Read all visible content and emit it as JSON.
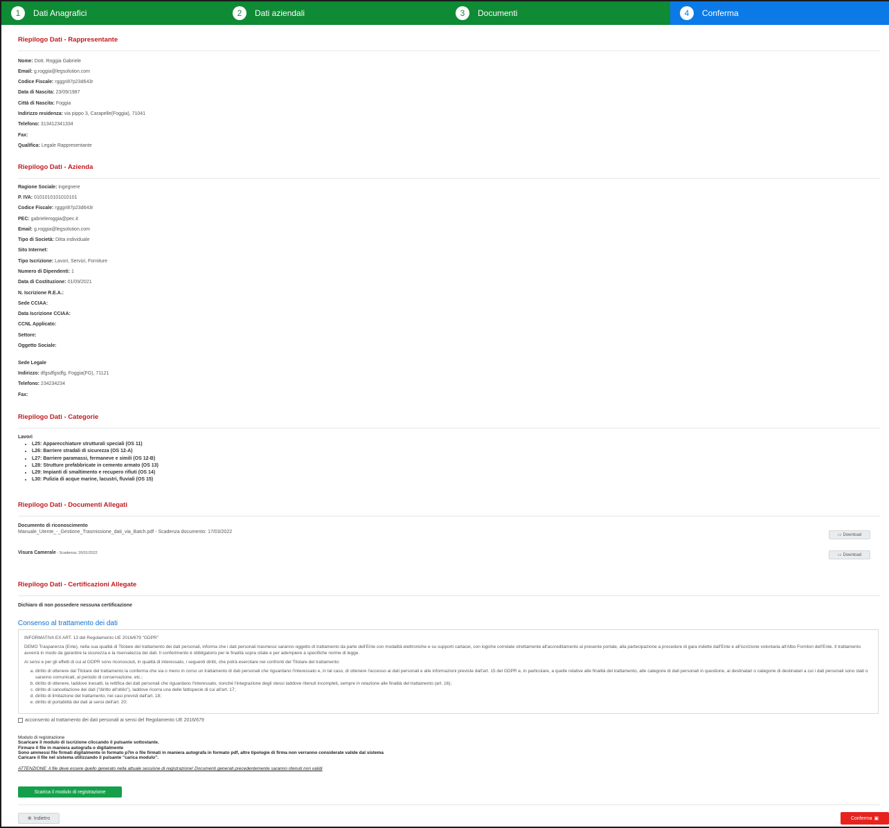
{
  "stepper": [
    {
      "num": "1",
      "label": "Dati Anagrafici"
    },
    {
      "num": "2",
      "label": "Dati aziendali"
    },
    {
      "num": "3",
      "label": "Documenti"
    },
    {
      "num": "4",
      "label": "Conferma"
    }
  ],
  "rappresentante": {
    "title": "Riepilogo Dati - Rappresentante",
    "fields": [
      {
        "label": "Nome:",
        "value": " Dott. Roggia Gabriele"
      },
      {
        "label": "Email:",
        "value": " g.roggia@legsolution.com"
      },
      {
        "label": "Codice Fiscale:",
        "value": " rgggri87p23d643r"
      },
      {
        "label": "Data di Nascita:",
        "value": " 23/09/1987"
      },
      {
        "label": "Città di Nascita:",
        "value": " Foggia"
      },
      {
        "label": "Indirizzo residenza:",
        "value": " via pippo 3, Carapelle(Foggia), 71041"
      },
      {
        "label": "Telefono:",
        "value": " 313412341334"
      },
      {
        "label": "Fax:",
        "value": ""
      },
      {
        "label": "Qualifica:",
        "value": " Legale Rappresentante"
      }
    ]
  },
  "azienda": {
    "title": "Riepilogo Dati - Azienda",
    "fields": [
      {
        "label": "Ragione Sociale:",
        "value": " ingegnere"
      },
      {
        "label": "P. IVA:",
        "value": " 0101010101010101"
      },
      {
        "label": "Codice Fiscale:",
        "value": " rgggri87p23d643r"
      },
      {
        "label": "PEC:",
        "value": " gabrieleroggia@pec.it"
      },
      {
        "label": "Email:",
        "value": " g.roggia@legsolution.com"
      },
      {
        "label": "Tipo di Società:",
        "value": " Ditta individuale"
      },
      {
        "label": "Sito Internet:",
        "value": ""
      },
      {
        "label": "Tipo Iscrizione:",
        "value": " Lavori, Servizi, Forniture"
      },
      {
        "label": "Numero di Dipendenti:",
        "value": " 1"
      },
      {
        "label": "Data di Costituzione:",
        "value": " 01/09/2021"
      },
      {
        "label": "N. Iscrizione R.E.A.:",
        "value": ""
      },
      {
        "label": "Sede CCIAA:",
        "value": ""
      },
      {
        "label": "Data Iscrizione CCIAA:",
        "value": ""
      },
      {
        "label": "CCNL Applicato:",
        "value": ""
      },
      {
        "label": "Settore:",
        "value": ""
      },
      {
        "label": "Oggetto Sociale:",
        "value": ""
      }
    ],
    "sede_label": "Sede Legale",
    "sede_fields": [
      {
        "label": "Indirizzo:",
        "value": " dfgsdfgsdfg, Foggia(FG), 71121"
      },
      {
        "label": "Telefono:",
        "value": " 234234234"
      },
      {
        "label": "Fax:",
        "value": ""
      }
    ]
  },
  "categorie": {
    "title": "Riepilogo Dati - Categorie",
    "group": "Lavori",
    "items": [
      "L25: Apparecchiature strutturali speciali (OS 11)",
      "L26: Barriere stradali di sicurezza (OS 12-A)",
      "L27: Barriere paramassi, fermaneve e simili (OS 12-B)",
      "L28: Strutture prefabbricate in cemento armato (OS 13)",
      "L29: Impianti di smaltimento e recupero rifiuti (OS 14)",
      "L30: Pulizia di acque marine, lacustri, fluviali (OS 15)"
    ]
  },
  "documenti": {
    "title": "Riepilogo Dati - Documenti Allegati",
    "doc1_title": "Documento di riconoscimento",
    "doc1_detail": "Manuale_Utente_-_Gestione_Trasmissione_dati_via_Batch.pdf - Scadenza documento: 17/03/2022",
    "doc2_title": "Visura Camerale",
    "doc2_detail": " - Scadenza: 20/01/2022",
    "download_label": "Download"
  },
  "certificazioni": {
    "title": "Riepilogo Dati - Certificazioni Allegate",
    "text": "Dichiaro di non possedere nessuna certificazione"
  },
  "consenso": {
    "title": "Consenso al trattamento dei dati",
    "heading": "INFORMATIVA EX ART. 13 del Regolamento UE 2016/679 \"GDPR\"",
    "para1": "DEMO Trasparenza (Ente), nella sua qualità di Titolare del trattamento dei dati personali, informa che i dati personali trasmessi saranno oggetto di trattamento da parte dell'Ente con modalità elettroniche e su supporti cartacei, con logiche correlate strettamente all'accreditamento al presente portale, alla partecipazione a procedure di gara indette dall'Ente e all'iscrizione volontaria all'Albo Fornitori dell'Ente. Il trattamento avverrà in modo da garantire la sicurezza e la riservatezza dei dati. Il conferimento è obbligatorio per le finalità sopra citate e per adempiere a specifiche norme di legge.",
    "para2": "Ai sensi e per gli effetti di cui al GDPR sono riconosciuti, in qualità di interessato, i seguenti diritti, che potrà esercitare nei confronti del Titolare del trattamento:",
    "items": [
      "diritto di ottenere dal Titolare del trattamento la conferma che sia o meno in corso un trattamento di dati personali che riguardano l'interessato e, in tal caso, di ottenere l'accesso ai dati personali e alle informazioni previste dall'art. 15 del GDPR e, in particolare, a quelle relative alle finalità del trattamento, alle categorie di dati personali in questione, ai destinatari o categorie di destinatari a cui i dati personali sono stati o saranno comunicati, al periodo di conservazione, etc.;",
      "diritto di ottenere, laddove inesatti, la rettifica dei dati personali che riguardano l'interessato, nonché l'integrazione degli stessi laddove ritenuti incompleti, sempre in relazione alle finalità del trattamento (art. 16);",
      "diritto di cancellazione dei dati (\"diritto all'oblio\"), laddove ricorra una delle fattispecie di cui all'art. 17;",
      "diritto di limitazione del trattamento, nei casi previsti dall'art. 18;",
      "diritto di portabilità dei dati ai sensi dell'art. 20;"
    ],
    "checkbox_label": "acconsento al trattamento dei dati personali ai sensi del Regolamento UE 2016/679"
  },
  "modulo": {
    "label": "Modulo di registrazione",
    "lines": [
      "Scaricare il modulo di iscrizione cliccando il pulsante sottostante.",
      "Firmare il file in maniera autografa o digitalmente",
      "Sono ammessi file firmati digitalmente in formato p7m o file firmati in maniera autografa in formato pdf, altre tipologie di firma non verranno considerate valide dal sistema",
      "Caricare il file nel sistema utilizzando il pulsante \"carica modulo\"."
    ],
    "warning": "ATTENZIONE: il file deve essere quello generato nella attuale sessione di registrazione! Documenti generati precedentemente saranno ritenuti non validi",
    "download_button": "Scarica il modulo di registrazione"
  },
  "footer": {
    "back_label": "Indietro",
    "confirm_label": "Conferma"
  },
  "colors": {
    "step_done": "#0f8a35",
    "step_active": "#0b7ae6",
    "section_title": "#c0191f",
    "confirm_button": "#e6231e",
    "download_module_button": "#14a04b"
  }
}
